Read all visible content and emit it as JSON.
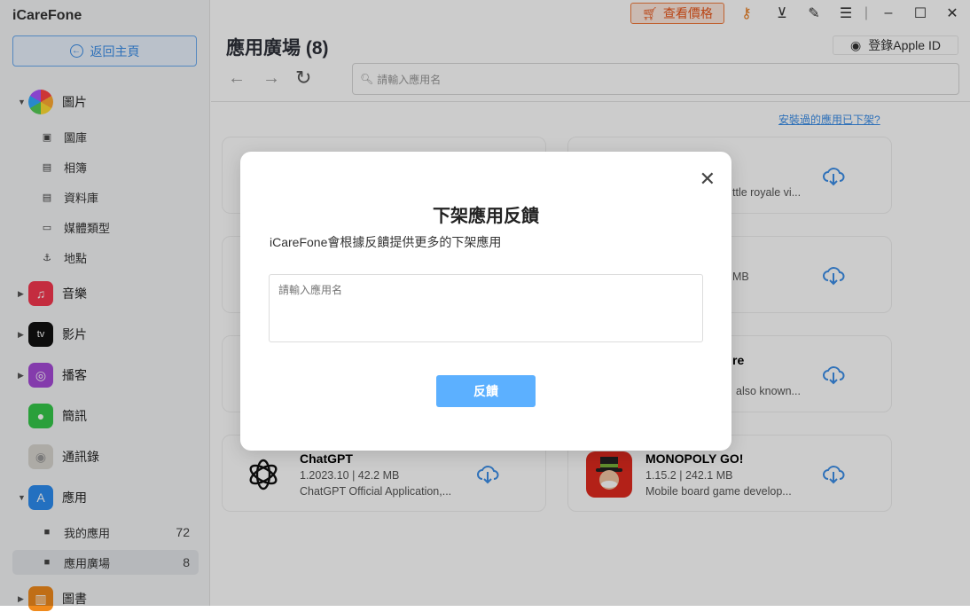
{
  "app": {
    "title": "iCareFone",
    "back_label": "返回主頁"
  },
  "titlebar": {
    "price_label": "查看價格"
  },
  "sidebar": {
    "categories": [
      {
        "label": "圖片",
        "expanded": true
      },
      {
        "label": "音樂"
      },
      {
        "label": "影片"
      },
      {
        "label": "播客"
      },
      {
        "label": "簡訊"
      },
      {
        "label": "通訊錄"
      },
      {
        "label": "應用",
        "expanded": true
      },
      {
        "label": "圖書"
      }
    ],
    "photo_items": [
      {
        "label": "圖庫"
      },
      {
        "label": "相簿"
      },
      {
        "label": "資料庫"
      },
      {
        "label": "媒體類型"
      },
      {
        "label": "地點"
      }
    ],
    "app_items": [
      {
        "label": "我的應用",
        "count": "72"
      },
      {
        "label": "應用廣場",
        "count": "8",
        "selected": true
      }
    ],
    "tv_icon_text": "tv"
  },
  "main": {
    "title": "應用廣場 (8)",
    "login_label": "登錄Apple ID",
    "search_placeholder": "請輸入應用名",
    "removed_link": "安裝過的應用已下架?",
    "card_fragments": [
      "ttle royale vi...",
      "MB",
      "re",
      "also known..."
    ],
    "apps": [
      {
        "name": "ChatGPT",
        "meta": "1.2023.10 | 42.2 MB",
        "desc": "ChatGPT Official Application,..."
      },
      {
        "name": "MONOPOLY GO!",
        "meta": "1.15.2 | 242.1 MB",
        "desc": "Mobile board game develop..."
      }
    ]
  },
  "modal": {
    "title": "下架應用反饋",
    "subtitle": "iCareFone會根據反饋提供更多的下架應用",
    "placeholder": "請輸入應用名",
    "submit_label": "反饋"
  },
  "colors": {
    "accent": "#3b8ee8",
    "price_orange": "#e8561a",
    "submit": "#5cb0ff"
  }
}
